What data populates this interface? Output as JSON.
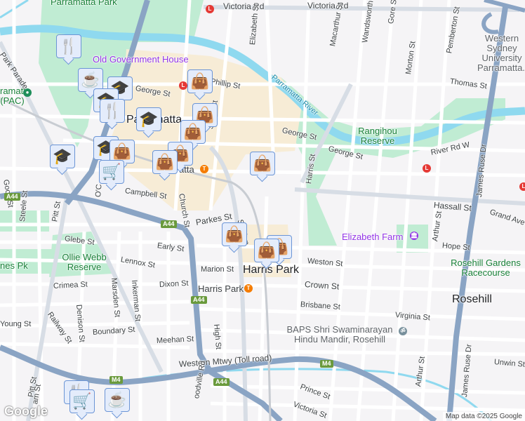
{
  "map": {
    "places": {
      "parramatta_park": "Parramatta Park",
      "old_government_house": "Old Government House",
      "riverside_pac": "ramatta (PAC)",
      "parramatta": "Parramatta",
      "wsu": "Western Sydney University Parramatta...",
      "rangihou": "Rangihou Reserve",
      "elizabeth_farm": "Elizabeth Farm",
      "rosehill_gardens": "Rosehill Gardens Racecourse",
      "rosehill": "Rosehill",
      "harris_park": "Harris Park",
      "harris_park_station": "Harris Park",
      "parramatta_station": "atta",
      "ollie_webb": "Ollie Webb Reserve",
      "jones_pk": "nes Pk",
      "baps": "BAPS Shri Swaminarayan Hindu Mandir, Rosehill",
      "parramatta_river": "Parramatta River"
    },
    "streets": {
      "victoria_rd_1": "Victoria Rd",
      "victoria_rd_2": "Victoria Rd",
      "park_parade": "Park Parade",
      "george_st_1": "George St",
      "george_st_2": "George St",
      "george_st_3": "George St",
      "phillip_st": "Phillip St",
      "smith_st": "Smith St",
      "elizabeth_st": "Elizabeth St",
      "macarthur_st": "Macarthur St",
      "wandsworth_st": "Wandsworth St",
      "gore_st": "Gore St",
      "morton_st": "Morton St",
      "pemberton_st": "Pemberton St",
      "thomas_st": "Thomas St",
      "harris_st": "Harris St",
      "river_rd_w": "River Rd W",
      "hassall_st": "Hassall St",
      "grand_ave": "Grand Ave",
      "james_ruse_dr_1": "James Ruse Dr",
      "james_ruse_dr_2": "James Ruse Dr",
      "arthur_st_1": "Arthur St",
      "arthur_st_2": "Arthur St",
      "hope_st": "Hope St",
      "weston_st": "Weston St",
      "crown_st": "Crown St",
      "brisbane_st": "Brisbane St",
      "virginia_st": "Virginia St",
      "unwin_st": "Unwin St",
      "prince_st": "Prince St",
      "victoria_st": "Victoria St",
      "good_st": "Good St",
      "steele_st": "Steele St",
      "pitt_st": "Pitt St",
      "campbell_st": "Campbell St",
      "church_st": "Church St",
      "parkes_st": "Parkes St",
      "station_st": "Station",
      "glebe_st": "Glebe St",
      "early_st": "Early St",
      "lennox_st": "Lennox St",
      "marion_st": "Marion St",
      "crimea_st": "Crimea St",
      "dixon_st": "Dixon St",
      "marsden_st": "Marsden St",
      "inkerman_st": "Inkerman St",
      "denison_st": "Denison St",
      "railway_st": "Railway St",
      "young_st": "Young St",
      "boundary_st": "Boundary St",
      "meehan_st": "Meehan St",
      "high_st": "High St",
      "western_mtwy": "Western Mtwy (Toll road)",
      "woodville_rd": "oodville Rd",
      "wigram_st": "am St",
      "oconnell_st": "O'C"
    },
    "shields": {
      "a44": "A44",
      "m4": "M4"
    },
    "markers": [
      {
        "type": "restaurant",
        "icon": "🍴"
      },
      {
        "type": "cafe",
        "icon": "☕"
      },
      {
        "type": "school",
        "icon": "🎓"
      },
      {
        "type": "restaurant",
        "icon": "🍴"
      },
      {
        "type": "school",
        "icon": "🎓"
      },
      {
        "type": "school",
        "icon": "🎓"
      },
      {
        "type": "school",
        "icon": "🎓"
      },
      {
        "type": "shopping",
        "icon": "👜"
      },
      {
        "type": "supermarket",
        "icon": "🛒"
      },
      {
        "type": "shopping",
        "icon": "👜"
      },
      {
        "type": "shopping",
        "icon": "👜"
      },
      {
        "type": "shopping",
        "icon": "👜"
      },
      {
        "type": "shopping",
        "icon": "👜"
      },
      {
        "type": "shopping",
        "icon": "👜"
      },
      {
        "type": "shopping",
        "icon": "👜"
      },
      {
        "type": "shopping",
        "icon": "👜"
      },
      {
        "type": "shopping",
        "icon": "👜"
      },
      {
        "type": "restaurant",
        "icon": "🍴"
      },
      {
        "type": "supermarket",
        "icon": "🛒"
      },
      {
        "type": "cafe",
        "icon": "☕"
      }
    ],
    "poi_glyphs": {
      "rail": "T",
      "light_rail": "L",
      "museum": "🏛",
      "temple": "ॐ"
    },
    "colors": {
      "water": "#8fd9ef",
      "park": "#c0ecd3",
      "major_road": "#8aa4c4",
      "cbd": "#f7ecd6",
      "marker_fill": "#e4ecfb",
      "marker_icon": "#0b4068"
    },
    "attribution": "Map data ©2025 Google",
    "logo": "Google"
  }
}
